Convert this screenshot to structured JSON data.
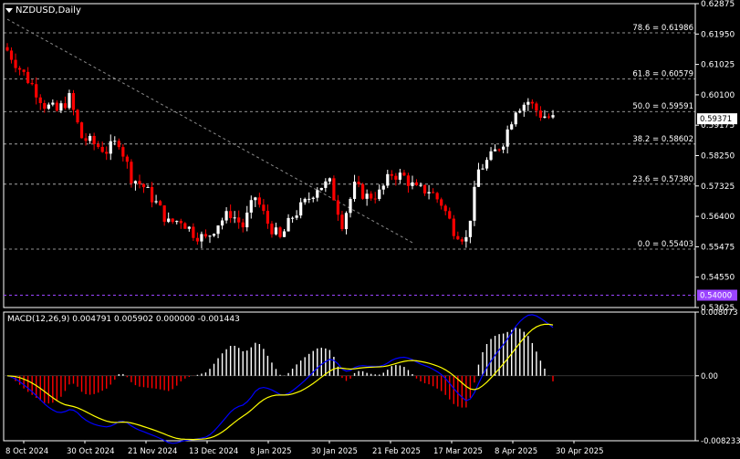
{
  "chart_title": "NZDUSD,Daily",
  "macd_title": "MACD(12,26,9) 0.004791 0.005902 0.000000 -0.001443",
  "colors": {
    "bull": "#ffffff",
    "bear": "#ff0000",
    "grid": "#ffffff",
    "trend": "#8a8a8a",
    "macd_line": "#0000ff",
    "signal_line": "#ffff00",
    "level_purple": "#9b44ff"
  },
  "chart_data": [
    {
      "type": "candlestick",
      "symbol": "NZDUSD",
      "timeframe": "Daily",
      "ylim": [
        0.53625,
        0.62875
      ],
      "y_ticks": [
        "0.62875",
        "0.61950",
        "0.61025",
        "0.60100",
        "0.59175",
        "0.58250",
        "0.57325",
        "0.56400",
        "0.55475",
        "0.54550",
        "0.53625"
      ],
      "x_ticks": [
        "8 Oct 2024",
        "30 Oct 2024",
        "21 Nov 2024",
        "13 Dec 2024",
        "8 Jan 2025",
        "30 Jan 2025",
        "21 Feb 2025",
        "17 Mar 2025",
        "8 Apr 2025",
        "30 Apr 2025"
      ],
      "fib_levels": [
        {
          "label": "78.6 = 0.61986",
          "value": 0.61986
        },
        {
          "label": "61.8 = 0.60579",
          "value": 0.60579
        },
        {
          "label": "50.0 = 0.59591",
          "value": 0.59591
        },
        {
          "label": "38.2 = 0.58602",
          "value": 0.58602
        },
        {
          "label": "23.6 = 0.57380",
          "value": 0.5738
        },
        {
          "label": "0.0 = 0.55403",
          "value": 0.55403
        }
      ],
      "current_price": "0.59371",
      "support_level": "0.54000",
      "trendline": {
        "start": [
          0.624,
          "8 Oct 2024"
        ],
        "end": [
          0.556,
          "21 Feb 2025"
        ]
      },
      "close_path": [
        0.6145,
        0.609,
        0.604,
        0.598,
        0.596,
        0.6,
        0.588,
        0.586,
        0.584,
        0.587,
        0.576,
        0.573,
        0.568,
        0.562,
        0.563,
        0.559,
        0.557,
        0.562,
        0.565,
        0.561,
        0.57,
        0.562,
        0.557,
        0.564,
        0.568,
        0.573,
        0.574,
        0.562,
        0.573,
        0.57,
        0.571,
        0.577,
        0.576,
        0.572,
        0.572,
        0.568,
        0.56,
        0.557,
        0.578,
        0.582,
        0.587,
        0.597,
        0.599,
        0.595,
        0.5937
      ]
    },
    {
      "type": "macd",
      "params": "12,26,9",
      "values": {
        "macd": 0.004791,
        "signal": 0.005902,
        "zero": 0.0,
        "histogram": -0.001443
      },
      "ylim": [
        -0.008233,
        0.008073
      ],
      "y_ticks": [
        "0.008073",
        "0.00",
        "-0.008233"
      ]
    }
  ]
}
